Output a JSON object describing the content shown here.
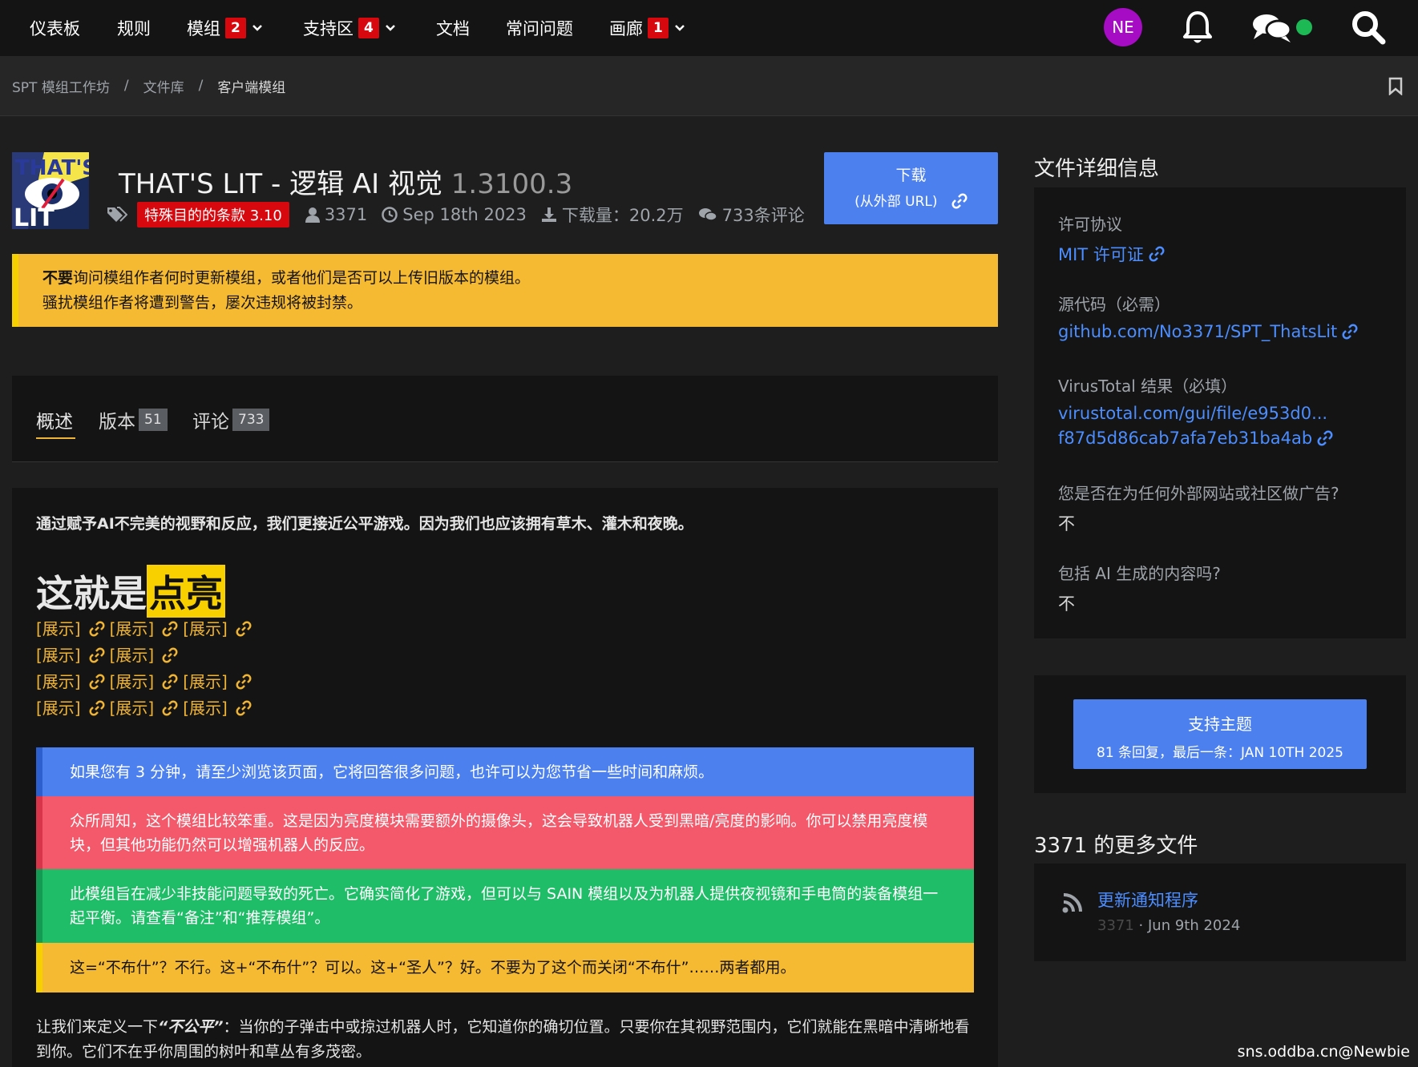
{
  "nav": {
    "items": [
      {
        "label": "仪表板"
      },
      {
        "label": "规则"
      },
      {
        "label": "模组",
        "badge": "2"
      },
      {
        "label": "支持区",
        "badge": "4"
      },
      {
        "label": "文档"
      },
      {
        "label": "常问问题"
      },
      {
        "label": "画廊",
        "badge": "1"
      }
    ],
    "avatar_initials": "NE",
    "online_status_color": "#1db954"
  },
  "breadcrumb": [
    "SPT 模组工作坊",
    "文件库",
    "客户端模组"
  ],
  "mod": {
    "title": "THAT'S LIT - 逻辑 AI 视觉",
    "version": "1.3100.3",
    "logo_text": "THAT'S LIT",
    "tag": "特殊目的的条款 3.10",
    "author": "3371",
    "date": "Sep 18th 2023",
    "downloads": "下载量：20.2万",
    "comments": "733条评论"
  },
  "download_button": {
    "label": "下载",
    "sub": "(从外部 URL)"
  },
  "warning": {
    "bold": "不要",
    "line1": "询问模组作者何时更新模组，或者他们是否可以上传旧版本的模组。",
    "line2": "骚扰模组作者将遭到警告，屡次违规将被封禁。"
  },
  "tabs": [
    {
      "label": "概述",
      "count": ""
    },
    {
      "label": "版本",
      "count": "51"
    },
    {
      "label": "评论",
      "count": "733"
    }
  ],
  "content": {
    "intro": "通过赋予AI不完美的视野和反应，我们更接近公平游戏。因为我们也应该拥有草木、灌木和夜晚。",
    "big_title_a": "这就是",
    "big_title_b": "点亮",
    "show_label": "[展示]",
    "show_rows": [
      3,
      2,
      3,
      3
    ],
    "callouts": [
      {
        "text": "如果您有 3 分钟，请至少浏览该页面，它将回答很多问题，也许可以为您节省一些时间和麻烦。",
        "color": "#4c80ee",
        "border": "#2d5fcf"
      },
      {
        "text": "众所周知，这个模组比较笨重。这是因为亮度模块需要额外的摄像头，这会导致机器人受到黑暗/亮度的影响。你可以禁用亮度模块，但其他功能仍然可以增强机器人的反应。",
        "color": "#f3596a",
        "border": "#d8354a"
      },
      {
        "text": "此模组旨在减少非技能问题导致的死亡。它确实简化了游戏，但可以与 SAIN 模组以及为机器人提供夜视镜和手电筒的装备模组一起平衡。请查看“备注”和“推荐模组”。",
        "color": "#1fbd68",
        "border": "#149a52"
      },
      {
        "text": "这=“不布什”？不行。这+“不布什”？可以。这+“圣人”？好。不要为了这个而关闭“不布什”……两者都用。",
        "color": "#f6b932",
        "border": "#f7d000"
      }
    ],
    "definition_a": "让我们来定义一下",
    "definition_b": "“不公平”",
    "definition_c": "：当你的子弹击中或掠过机器人时，它知道你的确切位置。只要你在其视野范围内，它们就能在黑暗中清晰地看到你。它们不在乎你周围的树叶和草丛有多茂密。"
  },
  "sidebar": {
    "details_title": "文件详细信息",
    "license_label": "许可协议",
    "license_value": "MIT 许可证",
    "source_label": "源代码（必需）",
    "source_value": "github.com/No3371/SPT_ThatsLit",
    "vt_label": "VirusTotal 结果（必填）",
    "vt_line1": "virustotal.com/gui/file/e953d0...",
    "vt_line2": "f87d5d86cab7afa7eb31ba4ab",
    "ads_label": "您是否在为任何外部网站或社区做广告?",
    "ads_value": "不",
    "ai_label": "包括 AI 生成的内容吗?",
    "ai_value": "不",
    "support_button": "支持主题",
    "support_sub": "81 条回复，最后一条：JAN 10TH 2025",
    "more_title": "3371 的更多文件",
    "more_item": "更新通知程序",
    "more_author": "3371",
    "more_date": " · Jun 9th 2024"
  },
  "watermark": "sns.oddba.cn@Newbie"
}
